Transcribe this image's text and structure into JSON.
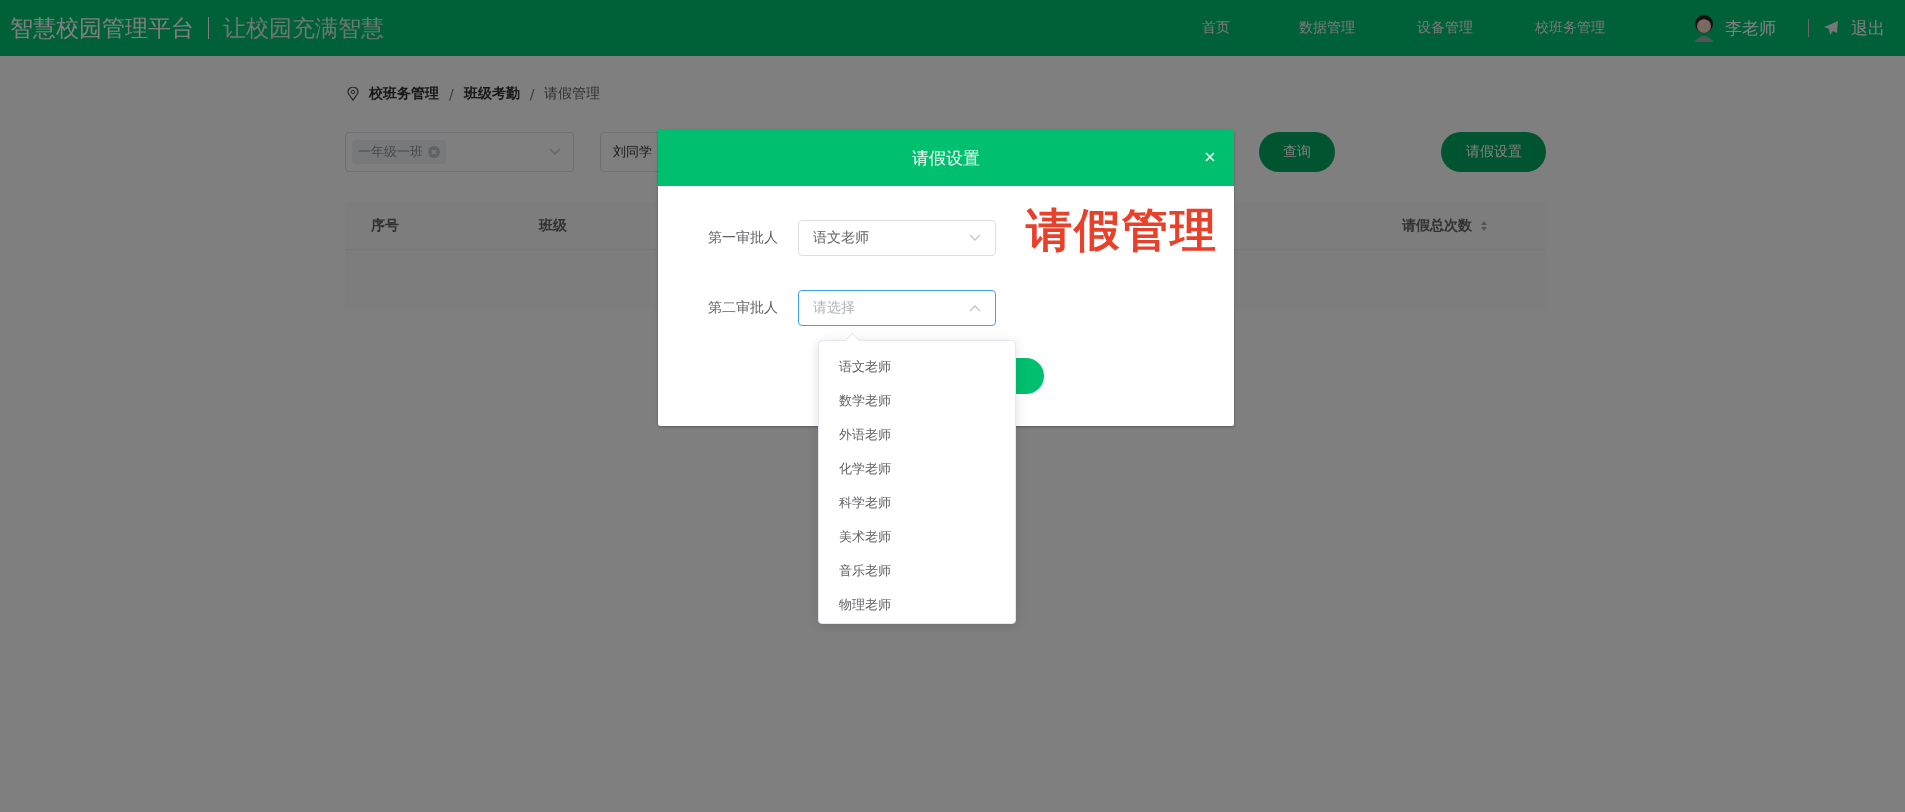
{
  "header": {
    "title": "智慧校园管理平台",
    "slogan": "让校园充满智慧",
    "nav": [
      {
        "label": "首页"
      },
      {
        "label": "数据管理"
      },
      {
        "label": "设备管理"
      },
      {
        "label": "校班务管理"
      }
    ],
    "user": "李老师",
    "logout": "退出"
  },
  "breadcrumb": [
    {
      "label": "校班务管理",
      "separator": "/"
    },
    {
      "label": "班级考勤",
      "separator": "/"
    },
    {
      "label": "请假管理"
    }
  ],
  "filters": {
    "class_tag": "一年级一班",
    "student": "刘同学",
    "search_button": "查询",
    "settings_button": "请假设置"
  },
  "table": {
    "columns": [
      {
        "label": "序号",
        "sortable": false
      },
      {
        "label": "班级",
        "sortable": false
      },
      {
        "label": "请假总次数",
        "sortable": true
      }
    ]
  },
  "dialog": {
    "title": "请假设置",
    "annotation": "请假管理",
    "fields": [
      {
        "label": "第一审批人",
        "value": "语文老师",
        "focused": false
      },
      {
        "label": "第二审批人",
        "placeholder": "请选择",
        "focused": true
      }
    ],
    "options": [
      {
        "label": "语文老师"
      },
      {
        "label": "数学老师"
      },
      {
        "label": "外语老师"
      },
      {
        "label": "化学老师"
      },
      {
        "label": "科学老师"
      },
      {
        "label": "美术老师"
      },
      {
        "label": "音乐老师"
      },
      {
        "label": "物理老师"
      }
    ]
  }
}
